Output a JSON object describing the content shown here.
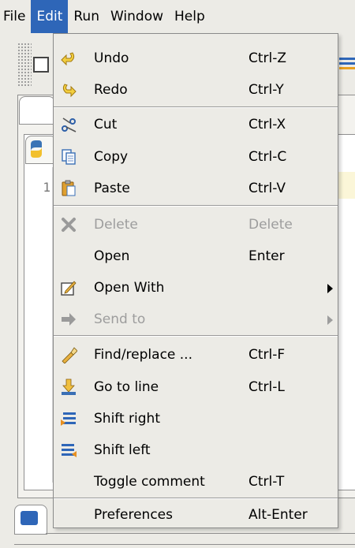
{
  "menubar": {
    "items": [
      "File",
      "Edit",
      "Run",
      "Window",
      "Help"
    ],
    "active": "Edit"
  },
  "editor": {
    "line_number": "1"
  },
  "edit_menu": {
    "items": [
      {
        "label": "Undo",
        "shortcut": "Ctrl-Z",
        "icon": "undo-icon",
        "enabled": true
      },
      {
        "label": "Redo",
        "shortcut": "Ctrl-Y",
        "icon": "redo-icon",
        "enabled": true
      },
      {
        "label": "Cut",
        "shortcut": "Ctrl-X",
        "icon": "scissors-icon",
        "enabled": true
      },
      {
        "label": "Copy",
        "shortcut": "Ctrl-C",
        "icon": "copy-icon",
        "enabled": true
      },
      {
        "label": "Paste",
        "shortcut": "Ctrl-V",
        "icon": "paste-icon",
        "enabled": true
      },
      {
        "label": "Delete",
        "shortcut": "Delete",
        "icon": "delete-x-icon",
        "enabled": false
      },
      {
        "label": "Open",
        "shortcut": "Enter",
        "icon": "",
        "enabled": true
      },
      {
        "label": "Open With",
        "shortcut": "",
        "icon": "open-with-icon",
        "enabled": true,
        "submenu": true
      },
      {
        "label": "Send to",
        "shortcut": "",
        "icon": "send-to-arrow-icon",
        "enabled": false,
        "submenu": true
      },
      {
        "label": "Find/replace ...",
        "shortcut": "Ctrl-F",
        "icon": "find-replace-icon",
        "enabled": true
      },
      {
        "label": "Go to line",
        "shortcut": "Ctrl-L",
        "icon": "go-to-line-icon",
        "enabled": true
      },
      {
        "label": "Shift right",
        "shortcut": "",
        "icon": "shift-right-icon",
        "enabled": true
      },
      {
        "label": "Shift left",
        "shortcut": "",
        "icon": "shift-left-icon",
        "enabled": true
      },
      {
        "label": "Toggle comment",
        "shortcut": "Ctrl-T",
        "icon": "",
        "enabled": true
      },
      {
        "label": "Preferences",
        "shortcut": "Alt-Enter",
        "icon": "",
        "enabled": true
      }
    ]
  },
  "colors": {
    "menu_bg": "#ecebe6",
    "highlight": "#2e66b8",
    "disabled_text": "#9d9d9d"
  }
}
